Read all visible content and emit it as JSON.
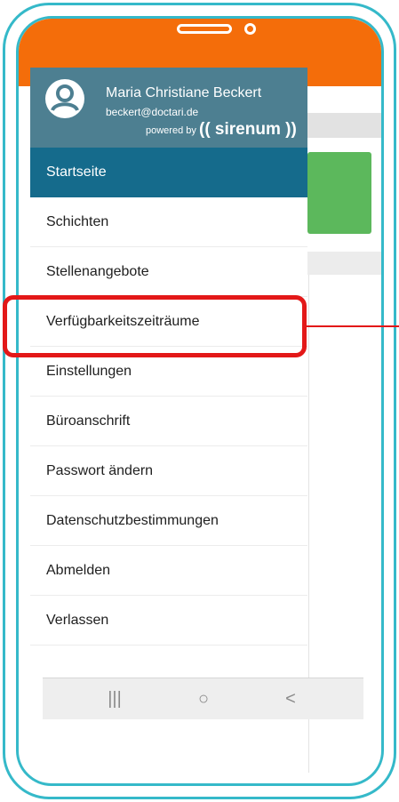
{
  "user": {
    "name": "Maria Christiane Beckert",
    "email": "beckert@doctari.de"
  },
  "branding": {
    "powered_by": "powered by",
    "brand_name": "(( sirenum ))"
  },
  "menu": {
    "items": [
      {
        "label": "Startseite",
        "active": true
      },
      {
        "label": "Schichten"
      },
      {
        "label": "Stellenangebote"
      },
      {
        "label": "Verfügbarkeitszeiträume",
        "highlighted": true
      },
      {
        "label": "Einstellungen"
      },
      {
        "label": "Büroanschrift"
      },
      {
        "label": "Passwort ändern"
      },
      {
        "label": "Datenschutzbestimmungen"
      },
      {
        "label": "Abmelden"
      },
      {
        "label": "Verlassen"
      }
    ]
  },
  "navbar": {
    "recents_icon": "|||",
    "home_icon": "○",
    "back_icon": "<"
  },
  "colors": {
    "frame": "#35b9c9",
    "header_orange": "#f46d0a",
    "drawer_header": "#4d7f91",
    "active_item": "#156b8c",
    "highlight": "#e31818",
    "card_green": "#5cb85c"
  }
}
